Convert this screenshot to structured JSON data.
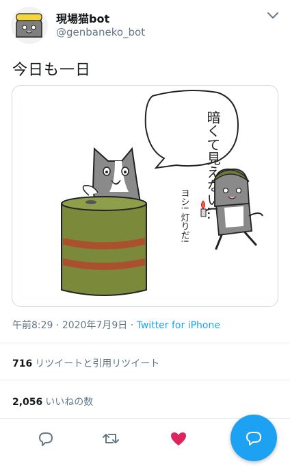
{
  "header": {
    "display_name": "現場猫bot",
    "handle": "@genbaneko_bot",
    "menu_icon": "chevron-down-icon"
  },
  "tweet": {
    "text": "今日も一日"
  },
  "media": {
    "speech_bubble_text": "暗くて見えない…",
    "small_cat_text": "ヨシ! 灯りだ!"
  },
  "meta": {
    "time": "午前8:29",
    "sep1": " · ",
    "date": "2020年7月9日",
    "sep2": " · ",
    "source": "Twitter for iPhone"
  },
  "stats": {
    "retweets_count": "716",
    "retweets_label": "リツイートと引用リツイート",
    "likes_count": "2,056",
    "likes_label": "いいねの数"
  },
  "actions": {
    "reply_icon": "reply-icon",
    "retweet_icon": "retweet-icon",
    "like_icon": "heart-icon",
    "compose_icon": "compose-reply-icon"
  },
  "colors": {
    "accent": "#1da1f2",
    "like": "#e0245e",
    "secondary_text": "#657786",
    "barrel_green": "#7a8a3a",
    "barrel_stripe": "#b4452e"
  }
}
